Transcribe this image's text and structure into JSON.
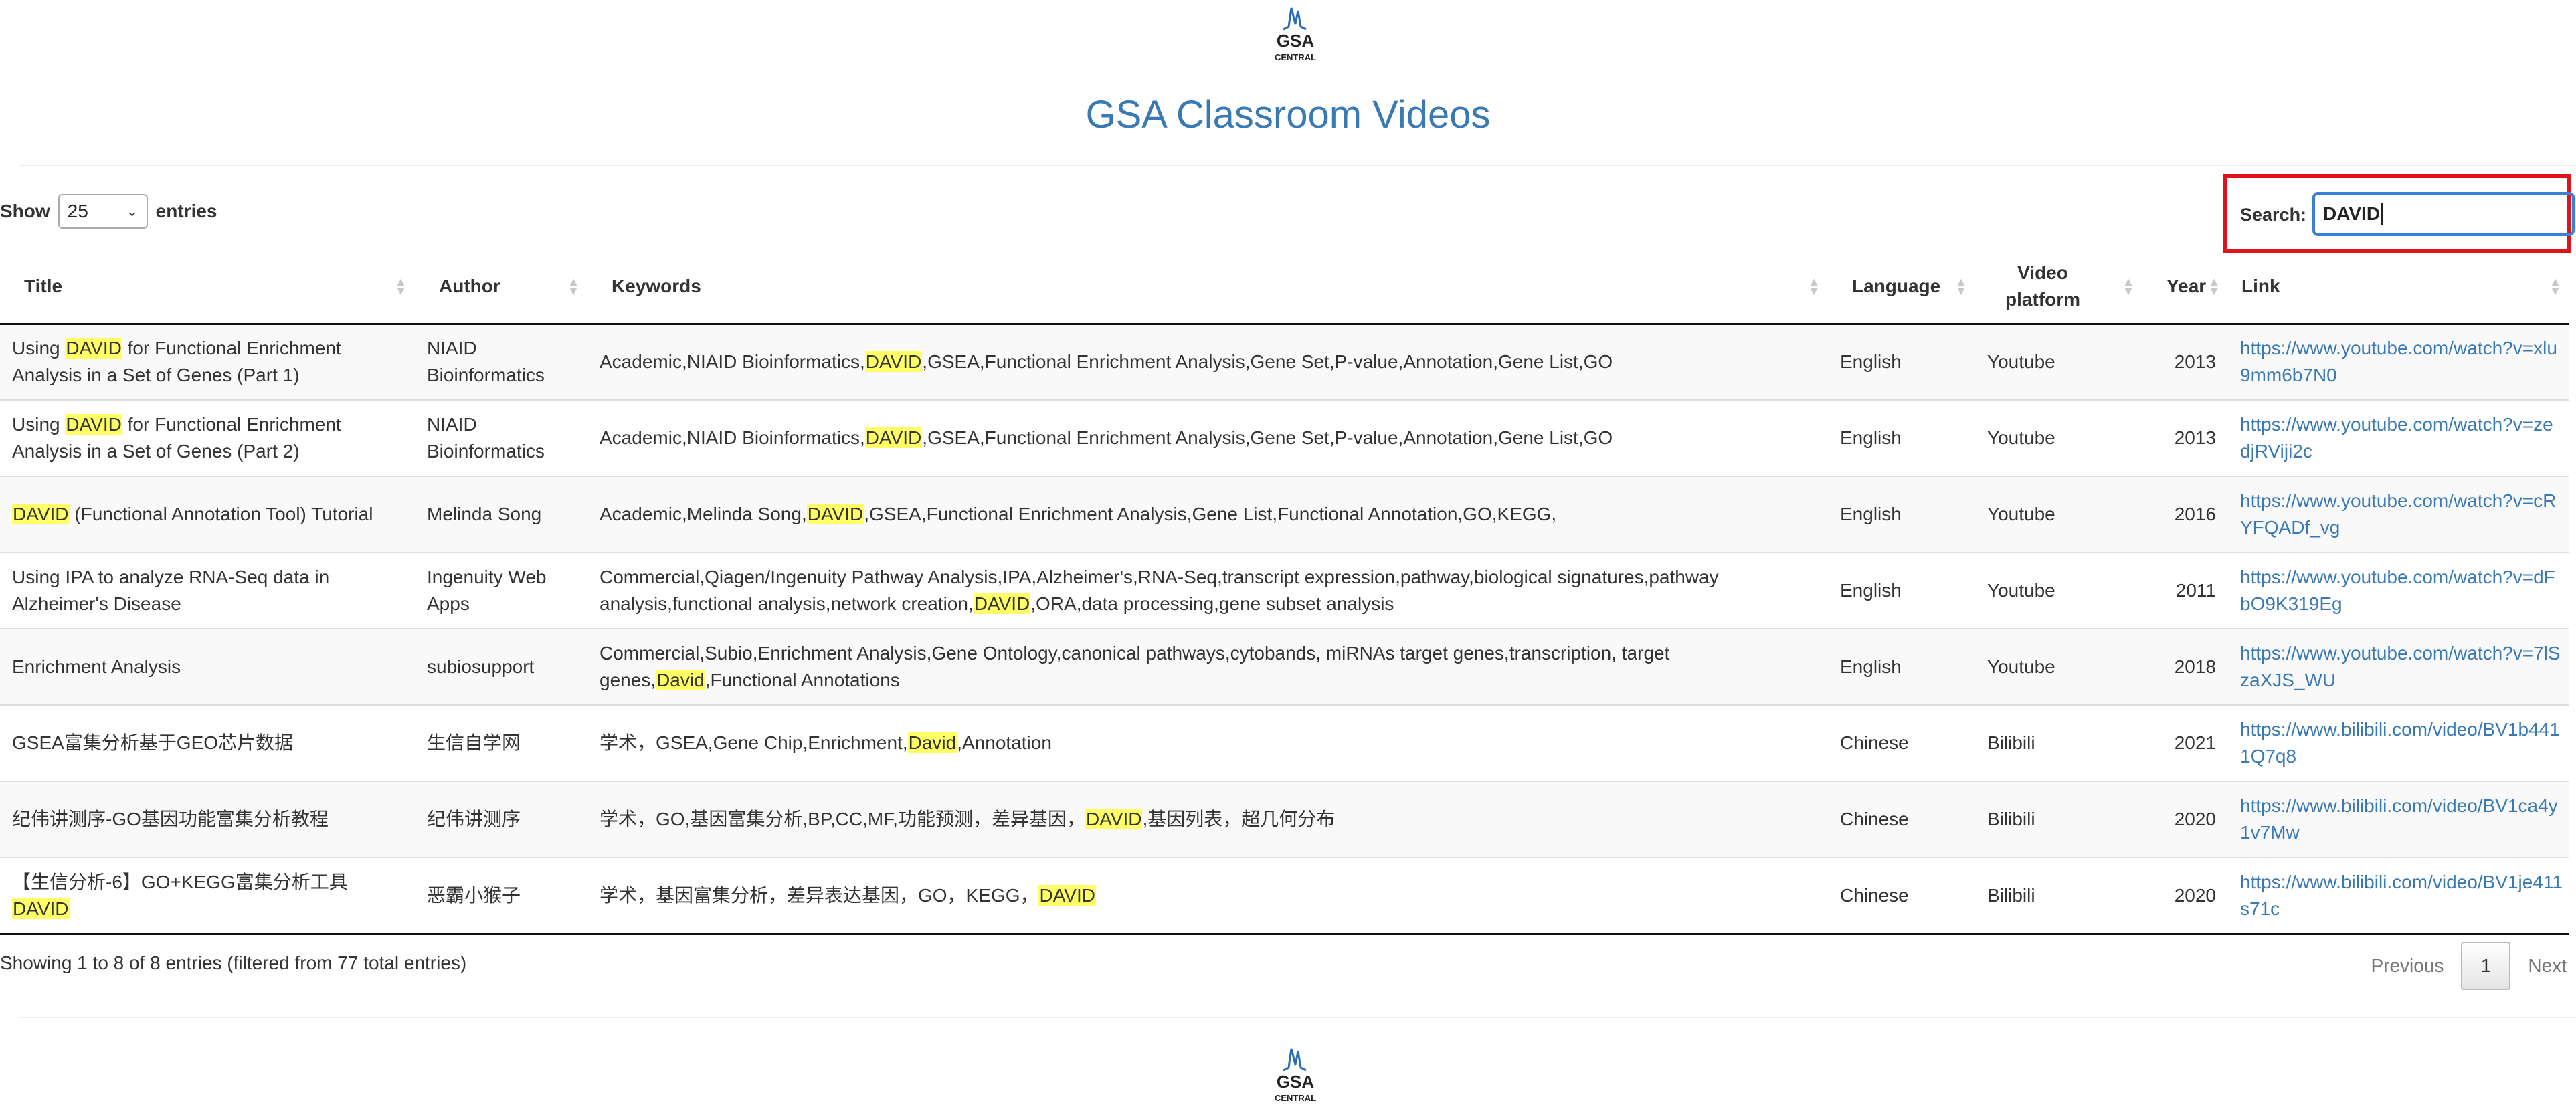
{
  "header": {
    "logo_text": "GSA CENTRAL",
    "title": "GSA Classroom Videos"
  },
  "length_control": {
    "show_label": "Show",
    "value": "25",
    "entries_label": "entries"
  },
  "search": {
    "label": "Search:",
    "value": "DAVID"
  },
  "columns": [
    "Title",
    "Author",
    "Keywords",
    "Language",
    "Video platform",
    "Year",
    "Link"
  ],
  "rows": [
    {
      "title": [
        "Using ",
        "DAVID",
        " for Functional Enrichment Analysis in a Set of Genes (Part 1)"
      ],
      "author": "NIAID Bioinformatics",
      "keywords": [
        "Academic,NIAID Bioinformatics,",
        "DAVID",
        ",GSEA,Functional Enrichment Analysis,Gene Set,P-value,Annotation,Gene List,GO"
      ],
      "language": "English",
      "platform": "Youtube",
      "year": "2013",
      "link": "https://www.youtube.com/watch?v=xlu9mm6b7N0"
    },
    {
      "title": [
        "Using ",
        "DAVID",
        " for Functional Enrichment Analysis in a Set of Genes (Part 2)"
      ],
      "author": "NIAID Bioinformatics",
      "keywords": [
        "Academic,NIAID Bioinformatics,",
        "DAVID",
        ",GSEA,Functional Enrichment Analysis,Gene Set,P-value,Annotation,Gene List,GO"
      ],
      "language": "English",
      "platform": "Youtube",
      "year": "2013",
      "link": "https://www.youtube.com/watch?v=zedjRViji2c"
    },
    {
      "title": [
        "",
        "DAVID",
        " (Functional Annotation Tool) Tutorial"
      ],
      "author": "Melinda Song",
      "keywords": [
        "Academic,Melinda Song,",
        "DAVID",
        ",GSEA,Functional Enrichment Analysis,Gene List,Functional Annotation,GO,KEGG,"
      ],
      "language": "English",
      "platform": "Youtube",
      "year": "2016",
      "link": "https://www.youtube.com/watch?v=cRYFQADf_vg"
    },
    {
      "title": [
        "Using IPA to analyze RNA-Seq data in Alzheimer's Disease",
        "",
        ""
      ],
      "author": "Ingenuity Web Apps",
      "keywords": [
        "Commercial,Qiagen/Ingenuity Pathway Analysis,IPA,Alzheimer's,RNA-Seq,transcript expression,pathway,biological signatures,pathway analysis,functional analysis,network creation,",
        "DAVID",
        ",ORA,data processing,gene subset analysis"
      ],
      "language": "English",
      "platform": "Youtube",
      "year": "2011",
      "link": "https://www.youtube.com/watch?v=dFbO9K319Eg"
    },
    {
      "title": [
        "Enrichment Analysis",
        "",
        ""
      ],
      "author": "subiosupport",
      "keywords": [
        "Commercial,Subio,Enrichment Analysis,Gene Ontology,canonical pathways,cytobands, miRNAs target genes,transcription, target genes,",
        "David",
        ",Functional Annotations"
      ],
      "language": "English",
      "platform": "Youtube",
      "year": "2018",
      "link": "https://www.youtube.com/watch?v=7lSzaXJS_WU"
    },
    {
      "title": [
        "GSEA富集分析基于GEO芯片数据",
        "",
        ""
      ],
      "author": "生信自学网",
      "keywords": [
        "学术，GSEA,Gene Chip,Enrichment,",
        "David",
        ",Annotation"
      ],
      "language": "Chinese",
      "platform": "Bilibili",
      "year": "2021",
      "link": "https://www.bilibili.com/video/BV1b4411Q7q8"
    },
    {
      "title": [
        "纪伟讲测序-GO基因功能富集分析教程",
        "",
        ""
      ],
      "author": "纪伟讲测序",
      "keywords": [
        "学术，GO,基因富集分析,BP,CC,MF,功能预测，差异基因，",
        "DAVID",
        ",基因列表，超几何分布"
      ],
      "language": "Chinese",
      "platform": "Bilibili",
      "year": "2020",
      "link": "https://www.bilibili.com/video/BV1ca4y1v7Mw"
    },
    {
      "title": [
        "【生信分析-6】GO+KEGG富集分析工具 ",
        "DAVID",
        ""
      ],
      "author": "恶霸小猴子",
      "keywords": [
        "学术，基因富集分析，差异表达基因，GO，KEGG，",
        "DAVID",
        ""
      ],
      "language": "Chinese",
      "platform": "Bilibili",
      "year": "2020",
      "link": "https://www.bilibili.com/video/BV1je411s71c"
    }
  ],
  "footer": {
    "info": "Showing 1 to 8 of 8 entries (filtered from 77 total entries)",
    "previous": "Previous",
    "page": "1",
    "next": "Next"
  },
  "colors": {
    "title_blue": "#3a7ab4",
    "highlight": "#ffff66",
    "search_focus": "#3c7fd4",
    "annotation_red": "#e0131a"
  }
}
